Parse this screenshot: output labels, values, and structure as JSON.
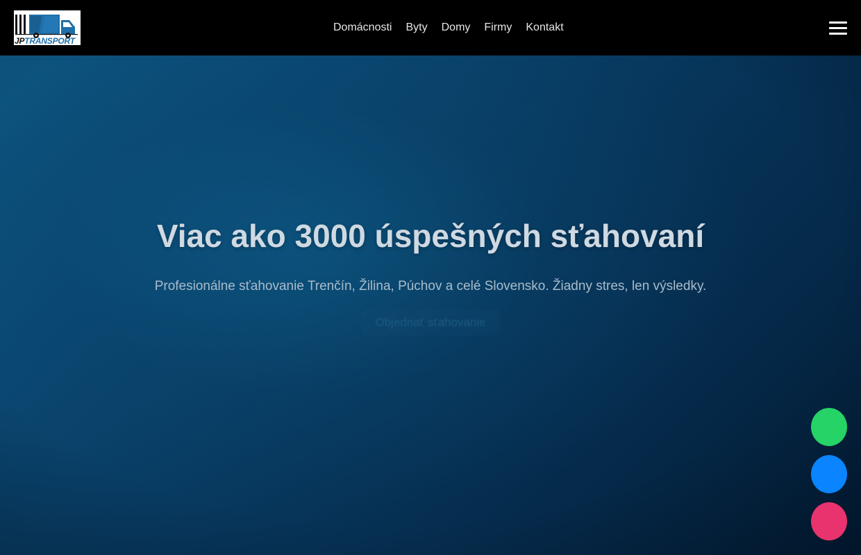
{
  "header": {
    "logo": {
      "text_jp": "JP",
      "text_transport": "TRANSPORT",
      "icon": "truck-icon"
    },
    "nav": [
      {
        "label": "Domácnosti"
      },
      {
        "label": "Byty"
      },
      {
        "label": "Domy"
      },
      {
        "label": "Firmy"
      },
      {
        "label": "Kontakt"
      }
    ],
    "menu_icon": "hamburger-menu-icon"
  },
  "hero": {
    "title": "Viac ako 3000 úspešných sťahovaní",
    "subtitle": "Profesionálne sťahovanie Trenčín, Žilina, Púchov a celé Slovensko. Žiadny stres, len výsledky.",
    "cta_label": "Objednať sťahovanie"
  },
  "floating_buttons": [
    {
      "icon": "whatsapp-icon",
      "color": "#25d366"
    },
    {
      "icon": "messenger-icon",
      "color": "#0a84ff"
    },
    {
      "icon": "instagram-icon",
      "color": "#e8336e"
    }
  ],
  "colors": {
    "header_bg": "#000000",
    "hero_accent": "#0d5a85",
    "logo_blue": "#1f6fa8"
  }
}
